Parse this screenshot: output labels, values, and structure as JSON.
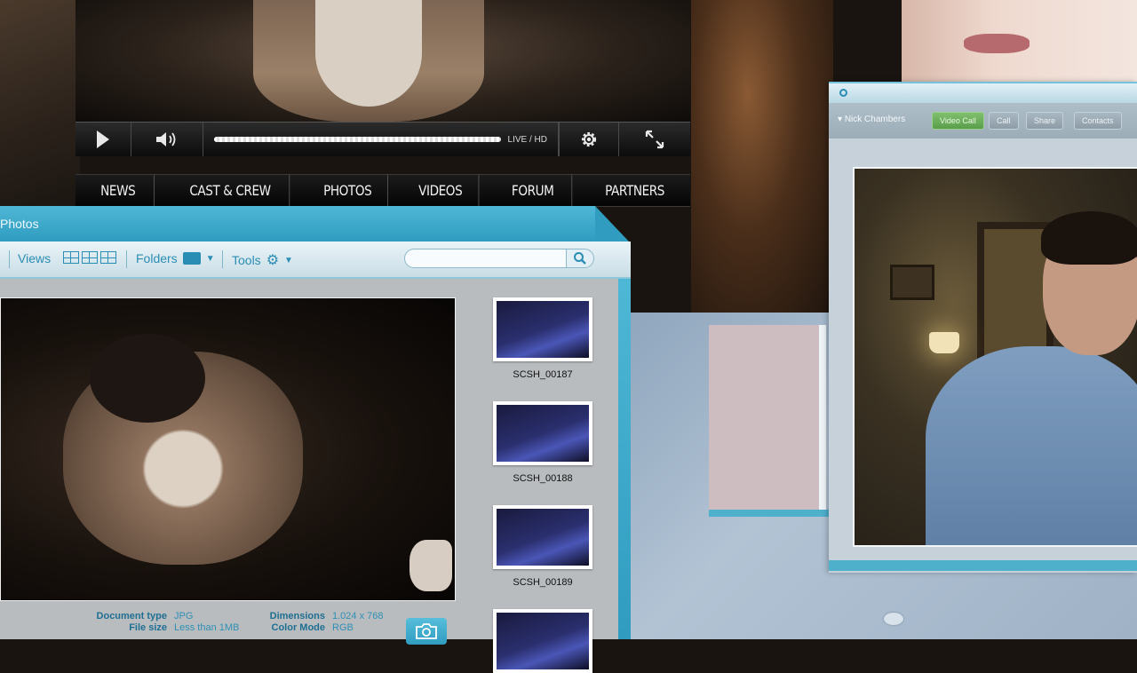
{
  "player": {
    "status_label": "LIVE / HD",
    "progress": 1.0,
    "icons": [
      "play-icon",
      "volume-icon",
      "gear-icon",
      "fullscreen-icon"
    ]
  },
  "site_nav": {
    "items": [
      {
        "label": "NEWS",
        "width": 96
      },
      {
        "label": "CAST & CREW",
        "width": 157
      },
      {
        "label": "PHOTOS",
        "width": 107
      },
      {
        "label": "VIDEOS",
        "width": 102
      },
      {
        "label": "FORUM",
        "width": 104
      },
      {
        "label": "PARTNERS",
        "width": 126
      }
    ]
  },
  "photos_window": {
    "title": "Photos",
    "toolbar": {
      "views_label": "Views",
      "folders_label": "Folders",
      "tools_label": "Tools"
    },
    "search": {
      "placeholder": ""
    },
    "metadata": {
      "document_type_label": "Document type",
      "document_type_value": "JPG",
      "file_size_label": "File size",
      "file_size_value": "Less than 1MB",
      "dimensions_label": "Dimensions",
      "dimensions_value": "1.024 x 768",
      "color_mode_label": "Color Mode",
      "color_mode_value": "RGB"
    },
    "thumbnails": [
      {
        "caption": "SCSH_00187"
      },
      {
        "caption": "SCSH_00188"
      },
      {
        "caption": "SCSH_00189"
      }
    ]
  },
  "call_window": {
    "contact_name": "Nick Chambers",
    "buttons": {
      "video_call": "Video Call",
      "call": "Call",
      "share": "Share",
      "contacts": "Contacts"
    }
  },
  "colors": {
    "accent": "#2f9cc0",
    "accent_light": "#4fb7d6",
    "toolbar_text": "#2a8db3",
    "green": "#5a9e4a"
  }
}
